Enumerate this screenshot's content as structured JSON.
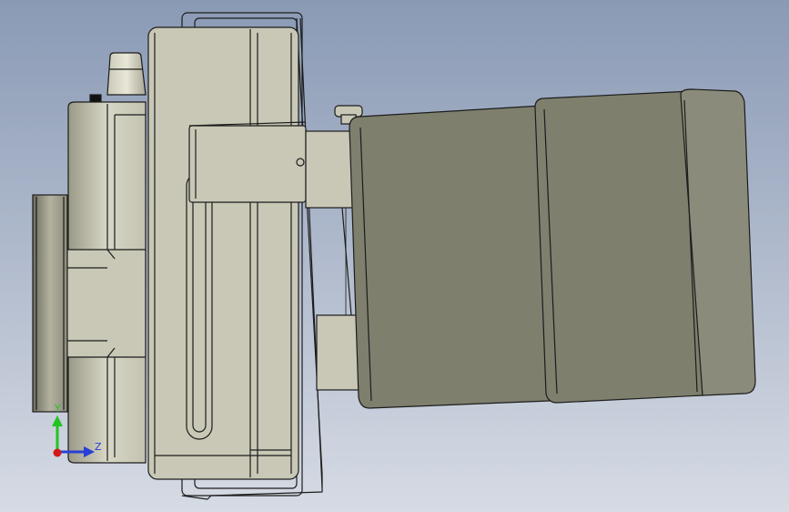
{
  "viewport": {
    "background_top": "#8a9ab5",
    "background_bottom": "#d6dbe4"
  },
  "triad": {
    "y_label": "Y",
    "z_label": "Z",
    "y_color": "#22c322",
    "z_color": "#2a3fd6",
    "origin_color": "#d01a1a"
  },
  "model": {
    "body_color": "#c9c8b6",
    "motor_color": "#7e7f6d",
    "edge_color": "#1c1c1c"
  }
}
